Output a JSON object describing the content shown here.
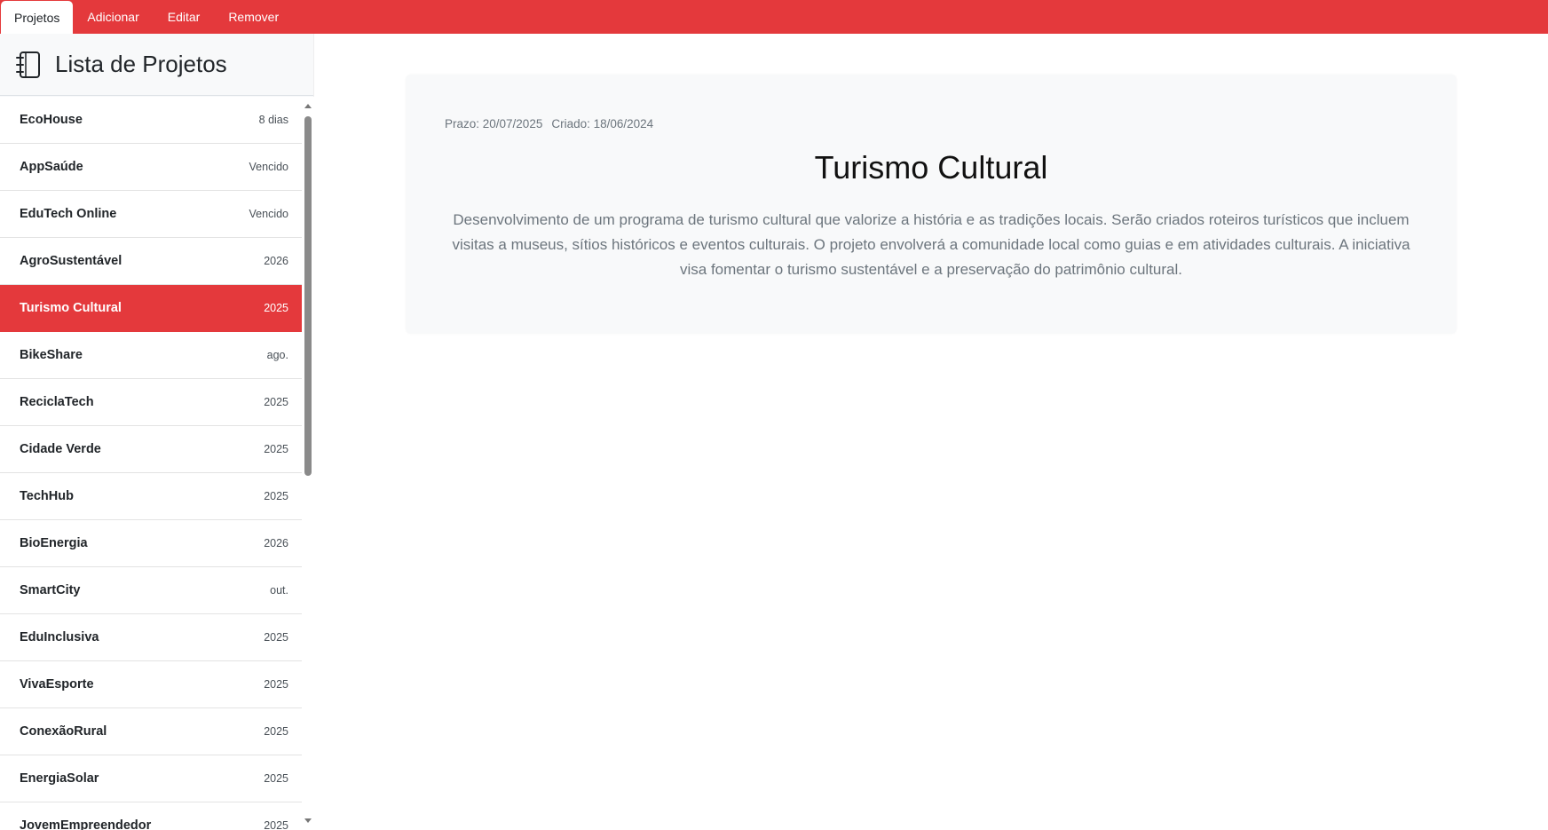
{
  "nav": {
    "tabs": [
      {
        "label": "Projetos",
        "active": true
      },
      {
        "label": "Adicionar",
        "active": false
      },
      {
        "label": "Editar",
        "active": false
      },
      {
        "label": "Remover",
        "active": false
      }
    ]
  },
  "sidebar": {
    "icon": "notebook-icon",
    "title": "Lista de Projetos",
    "items": [
      {
        "name": "EcoHouse",
        "meta": "8 dias"
      },
      {
        "name": "AppSaúde",
        "meta": "Vencido"
      },
      {
        "name": "EduTech Online",
        "meta": "Vencido"
      },
      {
        "name": "AgroSustentável",
        "meta": "2026"
      },
      {
        "name": "Turismo Cultural",
        "meta": "2025",
        "selected": true
      },
      {
        "name": "BikeShare",
        "meta": "ago."
      },
      {
        "name": "ReciclaTech",
        "meta": "2025"
      },
      {
        "name": "Cidade Verde",
        "meta": "2025"
      },
      {
        "name": "TechHub",
        "meta": "2025"
      },
      {
        "name": "BioEnergia",
        "meta": "2026"
      },
      {
        "name": "SmartCity",
        "meta": "out."
      },
      {
        "name": "EduInclusiva",
        "meta": "2025"
      },
      {
        "name": "VivaEsporte",
        "meta": "2025"
      },
      {
        "name": "ConexãoRural",
        "meta": "2025"
      },
      {
        "name": "EnergiaSolar",
        "meta": "2025"
      },
      {
        "name": "JovemEmpreendedor",
        "meta": "2025"
      }
    ]
  },
  "detail": {
    "deadline": "Prazo: 20/07/2025",
    "created": "Criado: 18/06/2024",
    "title": "Turismo Cultural",
    "description": "Desenvolvimento de um programa de turismo cultural que valorize a história e as tradições locais. Serão criados roteiros turísticos que incluem visitas a museus, sítios históricos e eventos culturais. O projeto envolverá a comunidade local como guias e em atividades culturais. A iniciativa visa fomentar o turismo sustentável e a preservação do patrimônio cultural."
  },
  "colors": {
    "accent": "#e4393c",
    "sidebar_bg": "#f8f9fa",
    "card_bg": "#f8f9fa"
  }
}
